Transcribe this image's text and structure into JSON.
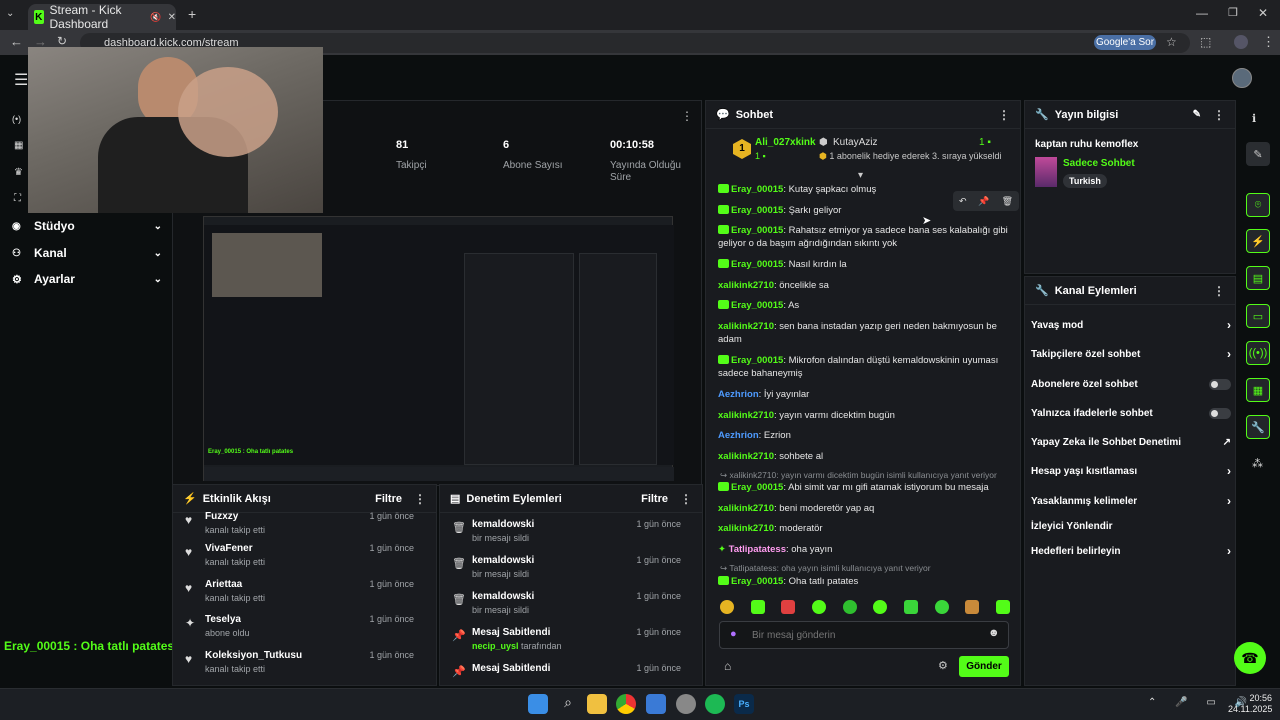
{
  "browser": {
    "tab_title": "Stream - Kick Dashboard",
    "url": "dashboard.kick.com/stream",
    "google_btn": "Google'a Sor"
  },
  "sidebar": {
    "items": [
      {
        "label": "Stüdyo"
      },
      {
        "label": "Kanal"
      },
      {
        "label": "Ayarlar"
      }
    ]
  },
  "stats": [
    {
      "value": "81",
      "label": "Takipçi"
    },
    {
      "value": "6",
      "label": "Abone Sayısı"
    },
    {
      "value": "00:10:58",
      "label": "Yayında Olduğu Süre"
    }
  ],
  "overlay_chat": "Eray_00015 : Oha tatlı patates",
  "chat": {
    "title": "Sohbet",
    "gifter_name": "Ali_027xkink",
    "gifter_count": "1",
    "gifted_to": "KutayAziz",
    "gifted_text": "1 abonelik hediye ederek 3. sıraya yükseldi",
    "gifted_count": "1",
    "messages": [
      {
        "user": "Eray_00015",
        "text": ": Kutay şapkacı olmuş"
      },
      {
        "user": "Eray_00015",
        "text": ": Şarkı geliyor"
      },
      {
        "user": "Eray_00015",
        "text": ": Rahatsız etmiyor ya sadece bana ses kalabalığı gibi geliyor o da başım ağrıdığından sıkıntı yok"
      },
      {
        "user": "Eray_00015",
        "text": ": Nasıl kırdın la"
      },
      {
        "user": "xalikink2710",
        "text": ": öncelikle sa"
      },
      {
        "user": "Eray_00015",
        "text": ": As"
      },
      {
        "user": "xalikink2710",
        "text": ": sen bana instadan yazıp geri neden bakmıyosun be adam"
      },
      {
        "user": "Eray_00015",
        "text": ": Mikrofon dalından düştü kemaldowskinin uyuması sadece bahaneymiş"
      },
      {
        "user": "Aezhrion",
        "text": ": İyi yayınlar"
      },
      {
        "user": "xalikink2710",
        "text": ": yayın varmı dicektim bugün"
      },
      {
        "user": "Aezhrion",
        "text": ": Ezrion"
      },
      {
        "user": "xalikink2710",
        "text": ": sohbete al"
      },
      {
        "user": "Eray_00015",
        "text": ": Abi simit var mı gifi atamak istiyorum bu mesaja"
      },
      {
        "user": "xalikink2710",
        "text": ": beni moderetör yap aq"
      },
      {
        "user": "xalikink2710",
        "text": ": moderatör"
      },
      {
        "user": "Tatlipatatess",
        "text": ": oha yayın"
      },
      {
        "user": "Eray_00015",
        "text": ": Oha tatlı patates"
      }
    ],
    "reply1": "xalikink2710: yayın varmı dicektim bugün isimli kullanıcıya yanıt veriyor",
    "reply2": "Tatlipatatess: oha yayın isimli kullanıcıya yanıt veriyor",
    "input_placeholder": "Bir mesaj gönderin",
    "send_label": "Gönder",
    "colors": {
      "green": "#53fc18",
      "blue": "#4e9bff",
      "pink": "#ff9cf0"
    }
  },
  "stream_info": {
    "title": "Yayın bilgisi",
    "stream_title": "kaptan ruhu kemoflex",
    "category": "Sadece Sohbet",
    "tag": "Turkish"
  },
  "channel_actions": {
    "title": "Kanal Eylemleri",
    "items": [
      {
        "label": "Yavaş mod",
        "control": "arrow"
      },
      {
        "label": "Takipçilere özel sohbet",
        "control": "arrow"
      },
      {
        "label": "Abonelere özel sohbet",
        "control": "toggle"
      },
      {
        "label": "Yalnızca ifadelerle sohbet",
        "control": "toggle"
      },
      {
        "label": "Yapay Zeka ile Sohbet Denetimi",
        "control": "external"
      },
      {
        "label": "Hesap yaşı kısıtlaması",
        "control": "arrow"
      },
      {
        "label": "Yasaklanmış kelimeler",
        "control": "arrow"
      },
      {
        "label": "İzleyici Yönlendir",
        "control": "none"
      },
      {
        "label": "Hedefleri belirleyin",
        "control": "arrow"
      }
    ]
  },
  "activity": {
    "title": "Etkinlik Akışı",
    "filter": "Filtre",
    "items": [
      {
        "name": "Fuzxzy",
        "sub": "kanalı takip etti",
        "time": "1 gün önce"
      },
      {
        "name": "VivaFener",
        "sub": "kanalı takip etti",
        "time": "1 gün önce"
      },
      {
        "name": "Ariettaa",
        "sub": "kanalı takip etti",
        "time": "1 gün önce"
      },
      {
        "name": "Teselya",
        "sub": "abone oldu",
        "time": "1 gün önce"
      },
      {
        "name": "Koleksiyon_Tutkusu",
        "sub": "kanalı takip etti",
        "time": "1 gün önce"
      }
    ]
  },
  "moderation": {
    "title": "Denetim Eylemleri",
    "filter": "Filtre",
    "items": [
      {
        "name": "kemaldowski",
        "sub": "bir mesajı sildi",
        "time": "1 gün önce"
      },
      {
        "name": "kemaldowski",
        "sub": "bir mesajı sildi",
        "time": "1 gün önce"
      },
      {
        "name": "kemaldowski",
        "sub": "bir mesajı sildi",
        "time": "1 gün önce"
      },
      {
        "name": "Mesaj Sabitlendi",
        "user": "necip_uysl",
        "sub": " tarafından",
        "time": "1 gün önce"
      },
      {
        "name": "Mesaj Sabitlendi",
        "sub": "",
        "time": "1 gün önce"
      }
    ]
  },
  "taskbar": {
    "time": "20:56",
    "date": "24.11.2025"
  }
}
